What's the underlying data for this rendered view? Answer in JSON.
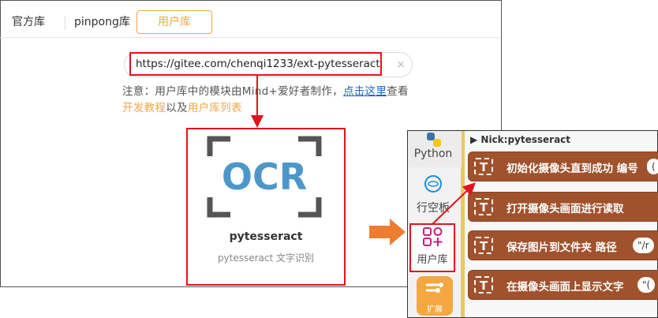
{
  "tabs": {
    "official": "官方库",
    "pinpong": "pinpong库",
    "user": "用户库"
  },
  "search": {
    "url": "https://gitee.com/chenqi1233/ext-pytesseract",
    "clear_icon": "×"
  },
  "notice": {
    "prefix": "注意：用户库中的模块由Mind+爱好者制作，",
    "link1": "点击这里",
    "middle": "查看",
    "link2": "开发教程",
    "mid2": "以及",
    "link3": "用户库列表"
  },
  "card": {
    "logo_text": "OCR",
    "title": "pytesseract",
    "desc": "pytesseract 文字识别"
  },
  "blocks_panel": {
    "categories": {
      "python": "Python",
      "board": "行空板",
      "user": "用户库",
      "ext": "扩展"
    },
    "header": "Nick:pytesseract",
    "blocks": [
      {
        "label": "初始化摄像头直到成功 编号",
        "pill": "("
      },
      {
        "label": "打开摄像头画面进行读取",
        "pill": ""
      },
      {
        "label": "保存图片到文件夹 路径",
        "pill": "\"/r"
      },
      {
        "label": "在摄像头画面上显示文字",
        "pill": "\"("
      }
    ]
  },
  "colors": {
    "accent": "#f5a742",
    "highlight": "#e0141d",
    "link": "#1a63c8",
    "block": "#a0522d"
  }
}
